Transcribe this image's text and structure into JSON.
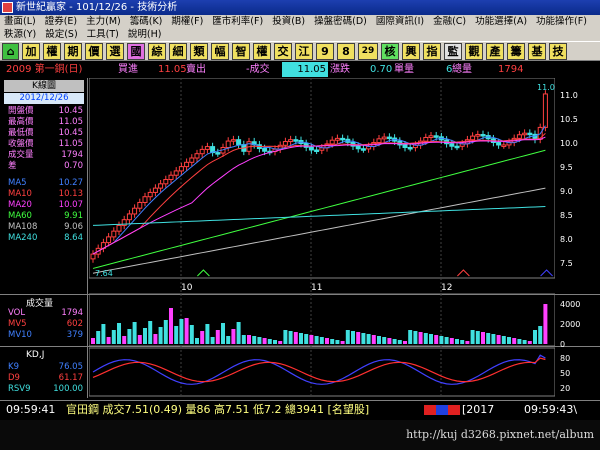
{
  "window": {
    "title": "新世紀贏家 - 101/12/26 - 技術分析"
  },
  "menu": {
    "row1": [
      "畫面(L)",
      "證券(E)",
      "主力(M)",
      "籌碼(K)",
      "期權(F)",
      "匯市利率(F)",
      "投資(B)",
      "操盤密碼(D)",
      "國際資訊(I)",
      "金融(C)",
      "功能選擇(A)",
      "功能操作(F)"
    ],
    "row2": [
      "秩源(Y)",
      "設定(S)",
      "工具(T)",
      "說明(H)"
    ]
  },
  "toolbar": {
    "buttons": [
      "加",
      "權",
      "期",
      "價",
      "選",
      "國",
      "綜",
      "細",
      "類",
      "幅",
      "智",
      "權",
      "交",
      "江",
      "9",
      "8",
      "29",
      "核",
      "興",
      "指",
      "監",
      "觀",
      "產",
      "籌",
      "基",
      "技"
    ],
    "home_icon": "home-icon"
  },
  "quote": {
    "code_name": "2009 第一銅(日)",
    "buy_label": "買進",
    "buy_value": "11.05",
    "sell_label": "賣出",
    "last_label": "成交",
    "last_value": "11.05",
    "change_label": "漲跌",
    "change_value": "0.70",
    "vol_label": "單量",
    "vol_value": "6",
    "total_label": "總量",
    "total_value": "1794"
  },
  "kline": {
    "panel_title": "K線圖",
    "date": "2012/12/26",
    "stats": [
      {
        "label": "開盤價",
        "value": "10.45",
        "color": "#ff80ff"
      },
      {
        "label": "最高價",
        "value": "11.05",
        "color": "#ff80ff"
      },
      {
        "label": "最低價",
        "value": "10.45",
        "color": "#ff80ff"
      },
      {
        "label": "收盤價",
        "value": "11.05",
        "color": "#ff80ff"
      },
      {
        "label": "成交量",
        "value": "1794",
        "color": "#ff80ff"
      },
      {
        "label": "差",
        "value": "0.70",
        "color": "#ff80ff"
      }
    ],
    "ma": [
      {
        "label": "MA5",
        "value": "10.27",
        "color": "#4080ff"
      },
      {
        "label": "MA10",
        "value": "10.13",
        "color": "#ff4040"
      },
      {
        "label": "MA20",
        "value": "10.07",
        "color": "#ff40ff"
      },
      {
        "label": "MA60",
        "value": "9.91",
        "color": "#40ff40"
      },
      {
        "label": "MA108",
        "value": "9.06",
        "color": "#c0c0c0"
      },
      {
        "label": "MA240",
        "value": "8.64",
        "color": "#40e0e0"
      }
    ],
    "price_high_label": "11.05",
    "price_low_label": "7.64",
    "y_ticks": [
      "11.0",
      "10.5",
      "10.0",
      "9.5",
      "9.0",
      "8.5",
      "8.0",
      "7.5"
    ],
    "x_labels": [
      "10",
      "11",
      "12"
    ]
  },
  "volume": {
    "panel_title": "成交量",
    "stats": [
      {
        "label": "VOL",
        "value": "1794",
        "color": "#ff80ff"
      },
      {
        "label": "MV5",
        "value": "602",
        "color": "#ff4040"
      },
      {
        "label": "MV10",
        "value": "379",
        "color": "#4080ff"
      }
    ],
    "y_ticks": [
      "4000",
      "2000",
      "0"
    ]
  },
  "kd": {
    "panel_title": "KD,J",
    "stats": [
      {
        "label": "K9",
        "value": "76.05",
        "color": "#4080ff"
      },
      {
        "label": "D9",
        "value": "61.17",
        "color": "#ff4040"
      },
      {
        "label": "RSV9",
        "value": "100.00",
        "color": "#40e0e0"
      }
    ],
    "y_ticks": [
      "80",
      "50",
      "20"
    ]
  },
  "status": {
    "time_left": "09:59:41",
    "ticker_text": "官田鋼 成交7.51(0.49) 量86 高7.51 低7.2 總3941 [名望股]",
    "index_label": "[2017",
    "time_right": "09:59:43\\"
  },
  "taskbar": {
    "watermark": "http://kuj d3268.pixnet.net/album"
  },
  "colors": {
    "up": "#ff4040",
    "down": "#40ff40",
    "accent": "#00c0ff",
    "bg": "#000000",
    "menu_bg": "#d4d0c8"
  }
}
